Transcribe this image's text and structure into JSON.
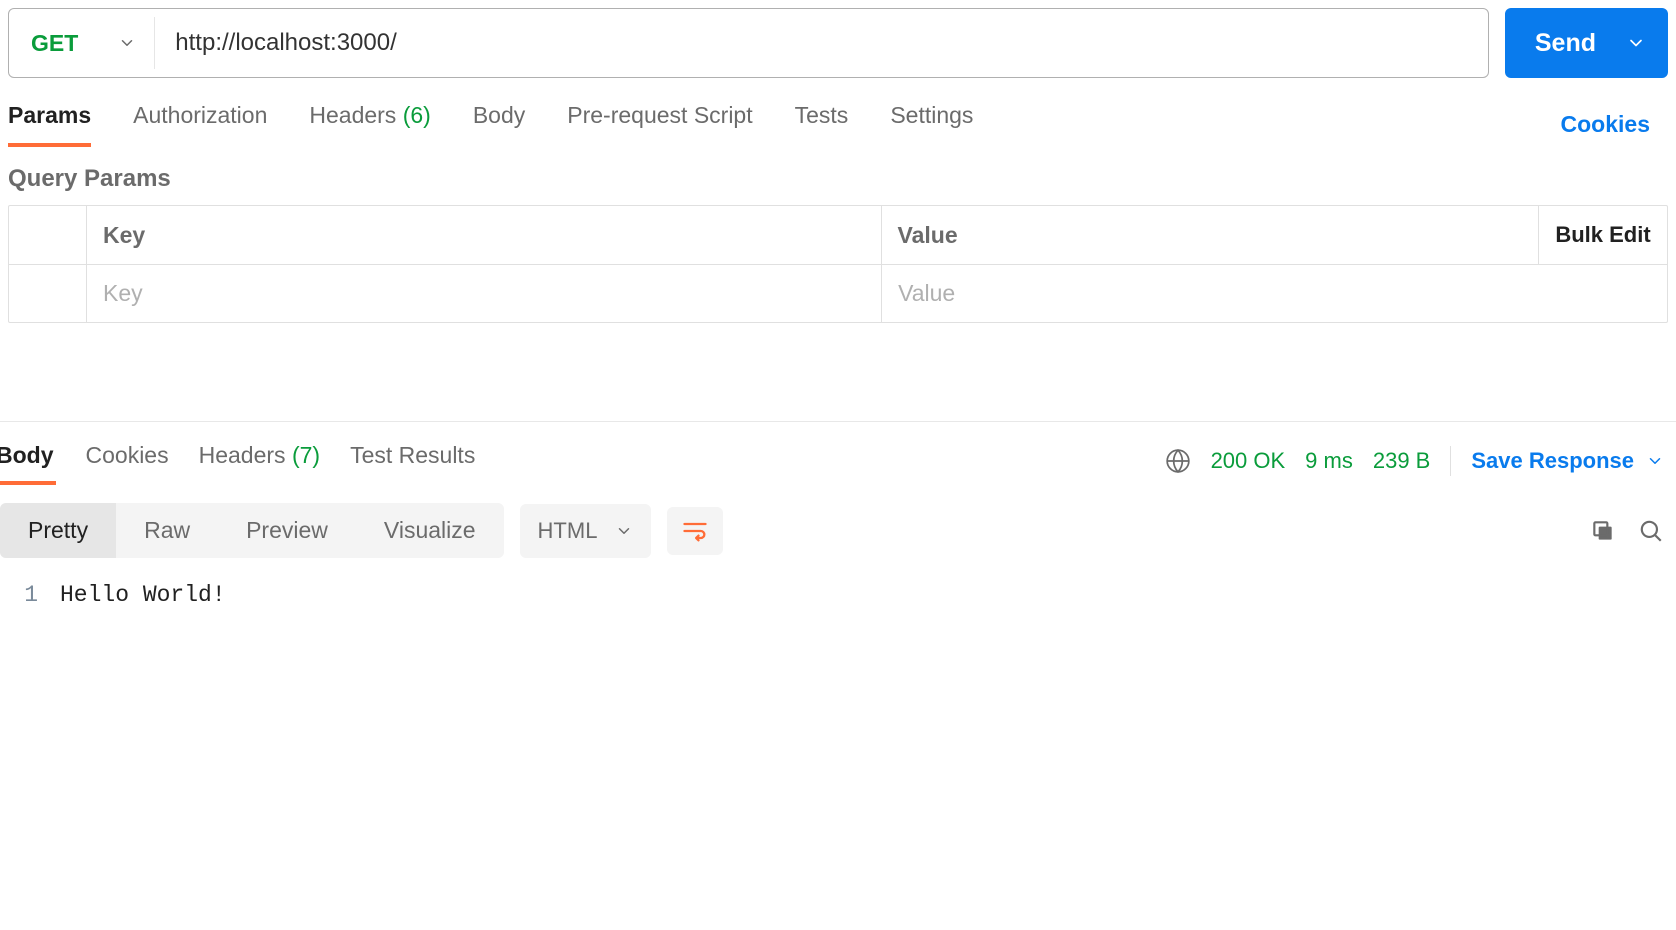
{
  "request": {
    "method": "GET",
    "url": "http://localhost:3000/",
    "send_label": "Send"
  },
  "req_tabs": {
    "params": "Params",
    "authorization": "Authorization",
    "headers": "Headers",
    "headers_count": "(6)",
    "body": "Body",
    "prerequest": "Pre-request Script",
    "tests": "Tests",
    "settings": "Settings",
    "cookies": "Cookies"
  },
  "query_params": {
    "section_title": "Query Params",
    "key_header": "Key",
    "value_header": "Value",
    "bulk_edit": "Bulk Edit",
    "key_placeholder": "Key",
    "value_placeholder": "Value"
  },
  "resp_tabs": {
    "body": "Body",
    "cookies": "Cookies",
    "headers": "Headers",
    "headers_count": "(7)",
    "test_results": "Test Results"
  },
  "resp_status": {
    "status": "200 OK",
    "time": "9 ms",
    "size": "239 B",
    "save": "Save Response"
  },
  "view_modes": {
    "pretty": "Pretty",
    "raw": "Raw",
    "preview": "Preview",
    "visualize": "Visualize",
    "format": "HTML"
  },
  "body_content": {
    "line1_num": "1",
    "line1_text": "Hello World!"
  }
}
